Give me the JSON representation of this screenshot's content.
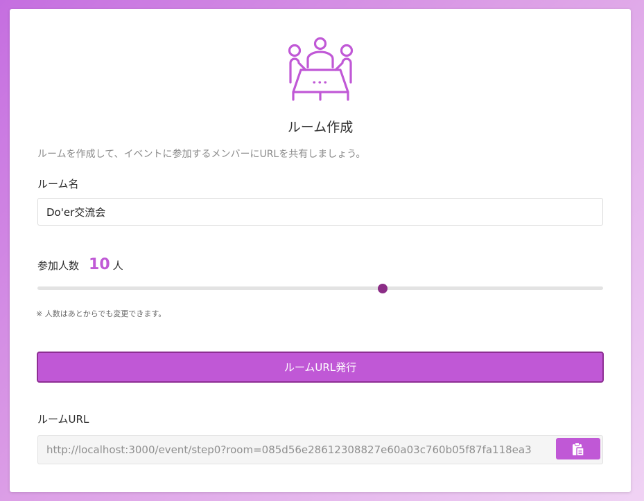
{
  "header": {
    "icon": "meeting-table-icon",
    "title": "ルーム作成",
    "description": "ルームを作成して、イベントに参加するメンバーにURLを共有しましょう。"
  },
  "room_name": {
    "label": "ルーム名",
    "value": "Do'er交流会"
  },
  "participants": {
    "label": "参加人数",
    "count": "10",
    "unit": "人",
    "slider_fraction": 0.61,
    "note": "※ 人数はあとからでも変更できます。"
  },
  "issue_button": {
    "label": "ルームURL発行"
  },
  "room_url": {
    "label": "ルームURL",
    "value": "http://localhost:3000/event/step0?room=085d56e28612308827e60a03c760b05f87fa118ea3",
    "copy_icon": "clipboard-icon"
  },
  "colors": {
    "accent": "#c058d6",
    "accent_border": "#8d2e93",
    "slider_thumb": "#8b2d86",
    "count_text": "#c05ad6"
  }
}
